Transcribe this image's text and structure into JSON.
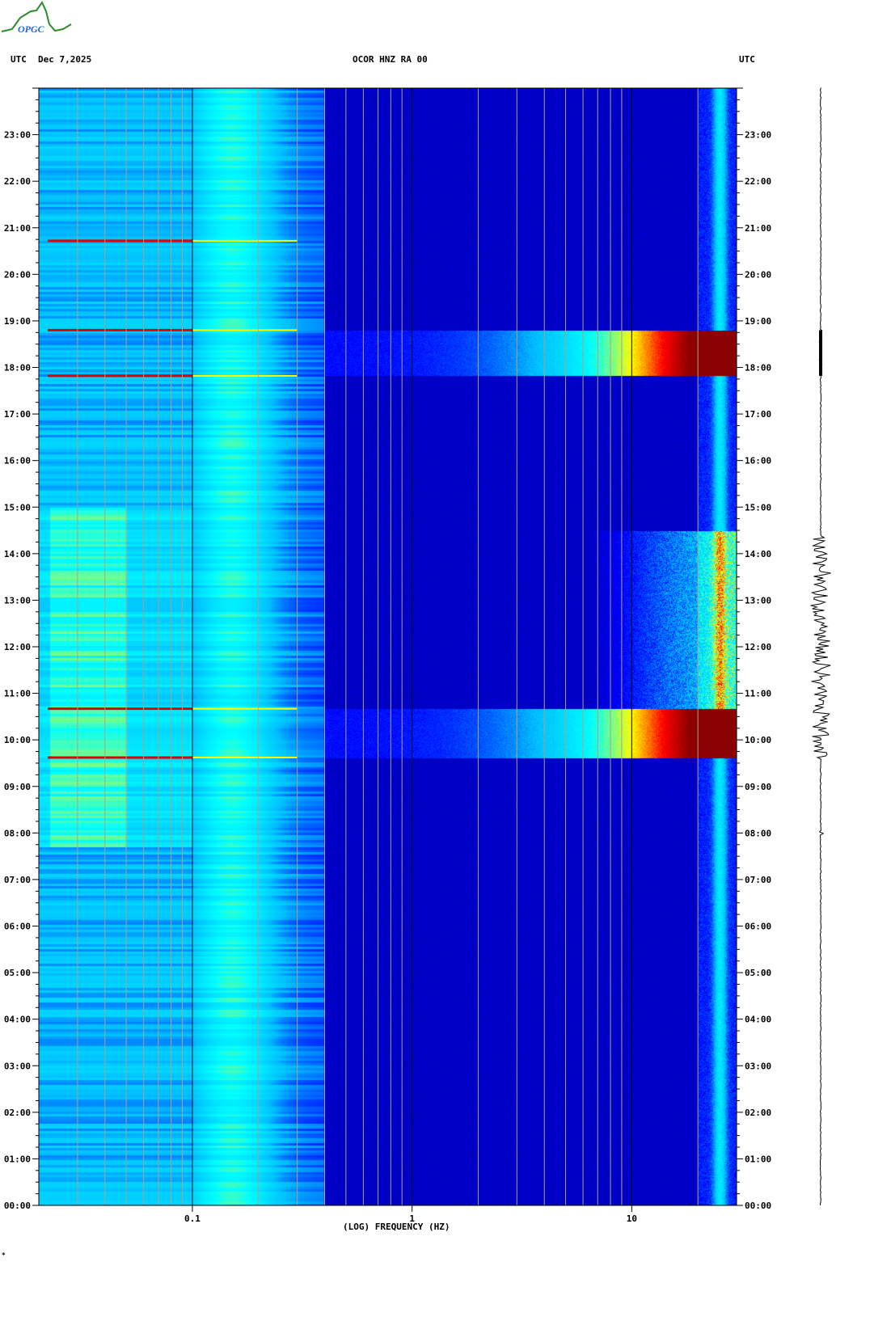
{
  "logo": {
    "text": "OPGC"
  },
  "header": {
    "left_tz": "UTC",
    "date": "Dec 7,2025",
    "station": "OCOR HNZ RA 00",
    "right_tz": "UTC"
  },
  "chart_data": {
    "type": "heatmap",
    "title": "OCOR HNZ RA 00",
    "xlabel": "(LOG) FREQUENCY (HZ)",
    "ylabel": "UTC",
    "xscale": "log",
    "xlim": [
      0.02,
      30
    ],
    "ylim_hours": [
      0,
      24
    ],
    "x_ticks": [
      {
        "value": 0.1,
        "label": "0.1"
      },
      {
        "value": 1,
        "label": "1"
      },
      {
        "value": 10,
        "label": "10"
      }
    ],
    "y_ticks": [
      "00:00",
      "01:00",
      "02:00",
      "03:00",
      "04:00",
      "05:00",
      "06:00",
      "07:00",
      "08:00",
      "09:00",
      "10:00",
      "11:00",
      "12:00",
      "13:00",
      "14:00",
      "15:00",
      "16:00",
      "17:00",
      "18:00",
      "19:00",
      "20:00",
      "21:00",
      "22:00",
      "23:00"
    ],
    "high_energy_events": [
      {
        "start_h": 9.62,
        "end_h": 10.67,
        "intensity": 1.0
      },
      {
        "start_h": 17.82,
        "end_h": 18.8,
        "intensity": 1.0
      }
    ],
    "elevated_noise": [
      {
        "start_h": 10.67,
        "end_h": 14.5,
        "intensity": 0.6
      }
    ],
    "transient_lines_h": [
      9.62,
      10.67,
      17.82,
      18.8,
      20.72
    ],
    "colormap": [
      "#00008b",
      "#0000ff",
      "#00bfff",
      "#00ffff",
      "#ffff00",
      "#ff0000",
      "#8b0000"
    ]
  },
  "footer": {
    "mark": "*"
  }
}
